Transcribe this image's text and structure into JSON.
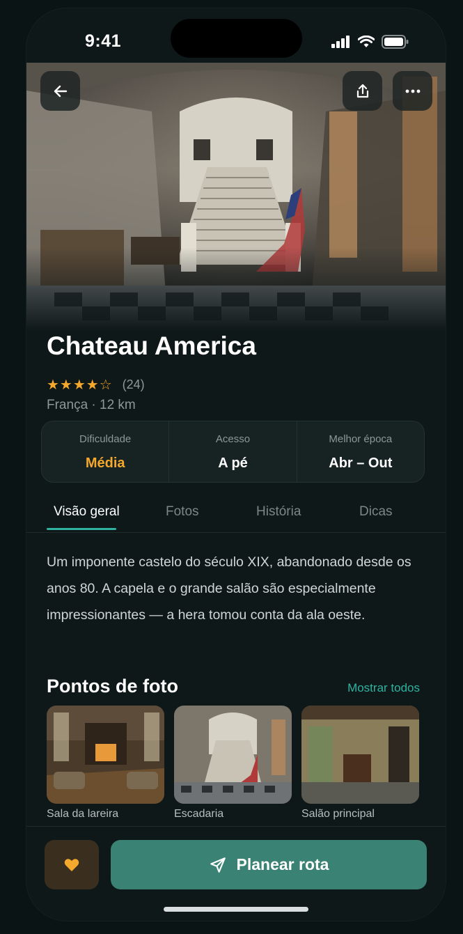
{
  "status_bar": {
    "time": "9:41"
  },
  "hero": {
    "back_icon": "arrow-left-icon",
    "share_icon": "share-icon",
    "more_icon": "ellipsis-icon"
  },
  "place": {
    "title": "Chateau America",
    "stars": "★★★★☆",
    "rating_value": 4,
    "rating_count": "(24)",
    "location": "França · 12 km"
  },
  "stats": [
    {
      "label": "Dificuldade",
      "value": "Média"
    },
    {
      "label": "Acesso",
      "value": "A pé"
    },
    {
      "label": "Melhor época",
      "value": "Abr – Out"
    }
  ],
  "tabs": [
    {
      "label": "Visão geral",
      "active": true
    },
    {
      "label": "Fotos",
      "active": false
    },
    {
      "label": "História",
      "active": false
    },
    {
      "label": "Dicas",
      "active": false
    }
  ],
  "description": "Um imponente castelo do século XIX, abandonado desde os anos 80. A capela e o grande salão são especialmente impressionantes — a hera tomou conta da ala oeste.",
  "photo_spots": {
    "title": "Pontos de foto",
    "show_all": "Mostrar todos",
    "items": [
      {
        "label": "Sala da lareira"
      },
      {
        "label": "Escadaria"
      },
      {
        "label": "Salão principal"
      }
    ]
  },
  "actions": {
    "favorite_icon": "heart-icon",
    "route_icon": "send-icon",
    "route_label": "Planear rota"
  },
  "colors": {
    "accent": "#2fb3a0",
    "highlight": "#f4a82c",
    "primary_button": "#3a8274",
    "background": "#0f1819"
  }
}
